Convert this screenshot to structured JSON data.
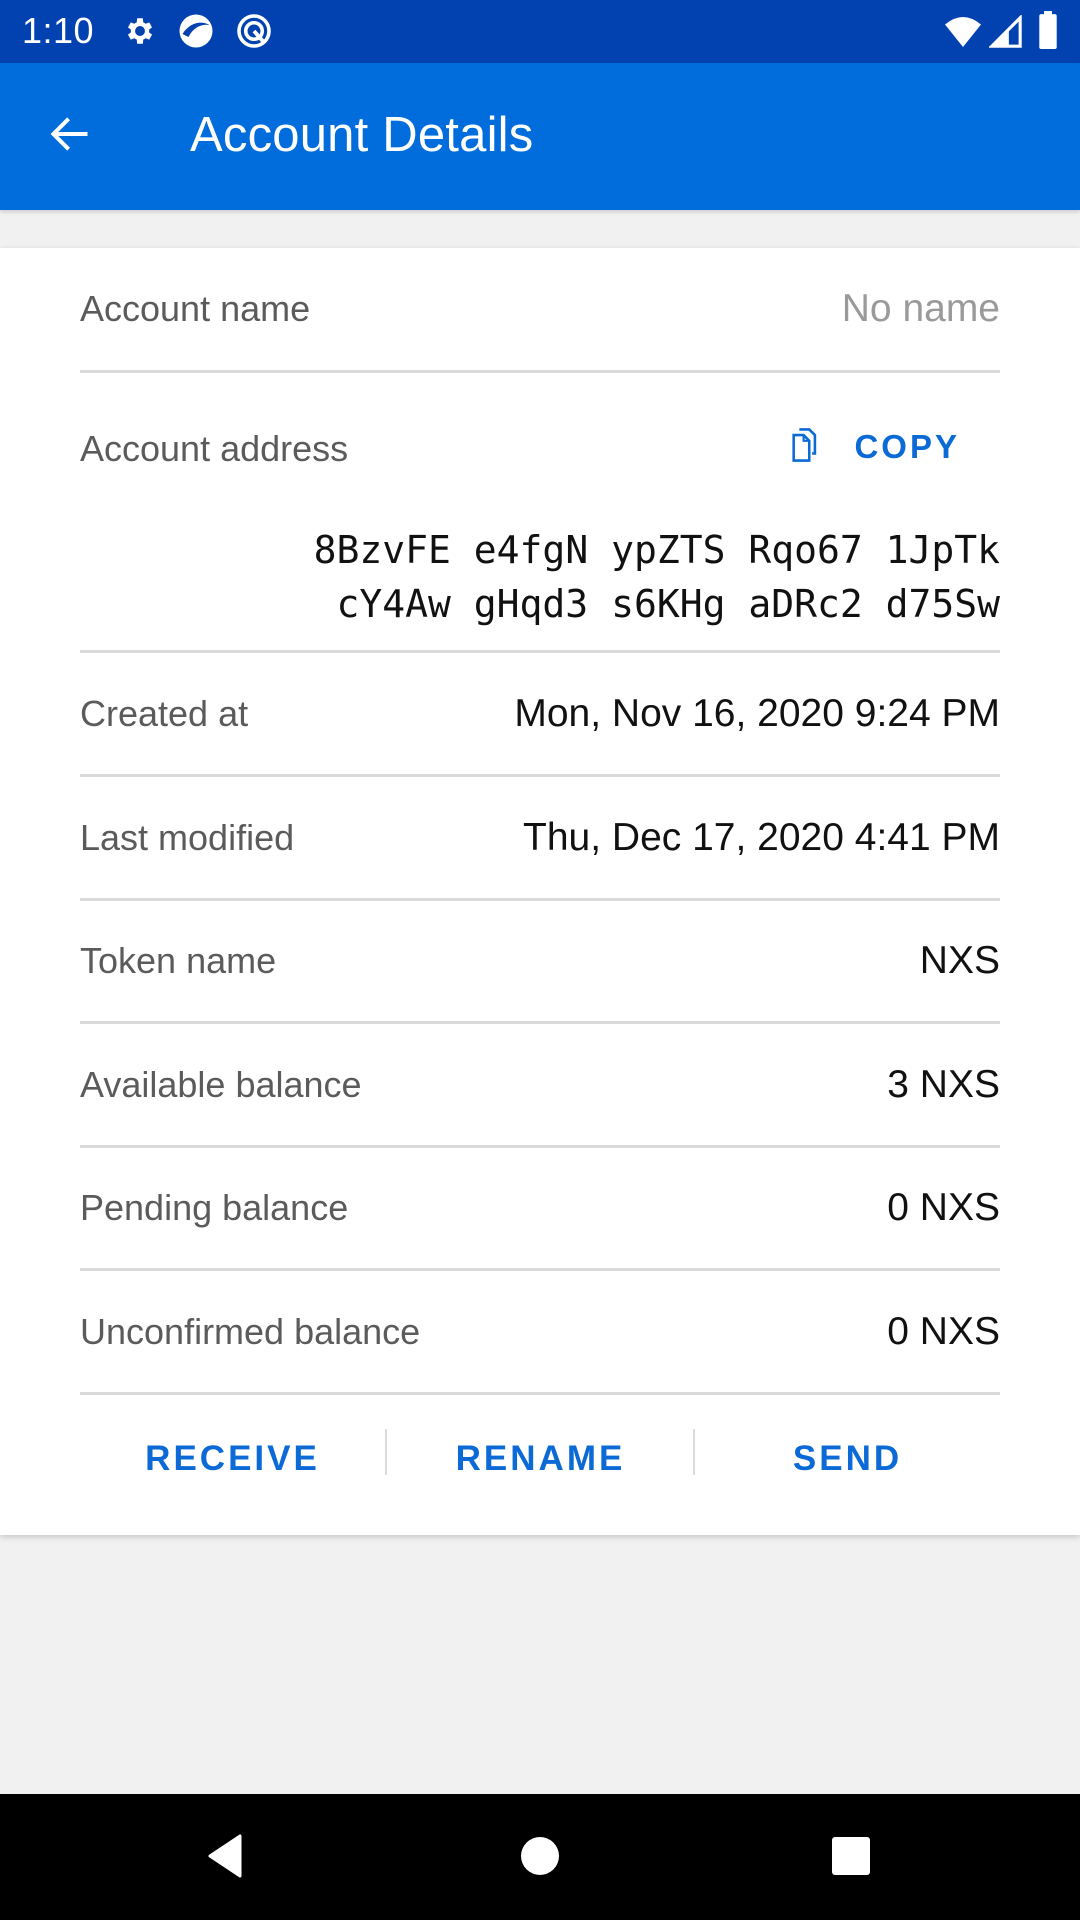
{
  "status_bar": {
    "time": "1:10",
    "left_icons": [
      "gear-icon",
      "app-swirl-icon",
      "app-q-icon"
    ],
    "right_icons": [
      "wifi-icon",
      "cell-signal-icon",
      "battery-icon"
    ]
  },
  "app_bar": {
    "title": "Account Details",
    "back_icon": "arrow-left-icon"
  },
  "details": {
    "account_name": {
      "label": "Account name",
      "value": "No name"
    },
    "account_address": {
      "label": "Account address",
      "copy_label": "COPY",
      "copy_icon": "copy-icon",
      "line1": "8BzvFE e4fgN ypZTS Rqo67 1JpTk",
      "line2": "cY4Aw gHqd3 s6KHg aDRc2 d75Sw"
    },
    "created_at": {
      "label": "Created at",
      "value": "Mon, Nov 16, 2020 9:24 PM"
    },
    "last_modified": {
      "label": "Last modified",
      "value": "Thu, Dec 17, 2020 4:41 PM"
    },
    "token_name": {
      "label": "Token name",
      "value": "NXS"
    },
    "available_balance": {
      "label": "Available balance",
      "value": "3 NXS"
    },
    "pending_balance": {
      "label": "Pending balance",
      "value": "0 NXS"
    },
    "unconfirmed_balance": {
      "label": "Unconfirmed balance",
      "value": "0 NXS"
    }
  },
  "actions": {
    "receive": "RECEIVE",
    "rename": "RENAME",
    "send": "SEND"
  },
  "nav_bar": {
    "buttons": [
      "back-triangle-icon",
      "home-circle-icon",
      "recents-square-icon"
    ]
  },
  "colors": {
    "status_bar": "#0242b0",
    "app_bar": "#016ddd",
    "accent": "#0b6ad6",
    "background": "#f1f1f1"
  }
}
